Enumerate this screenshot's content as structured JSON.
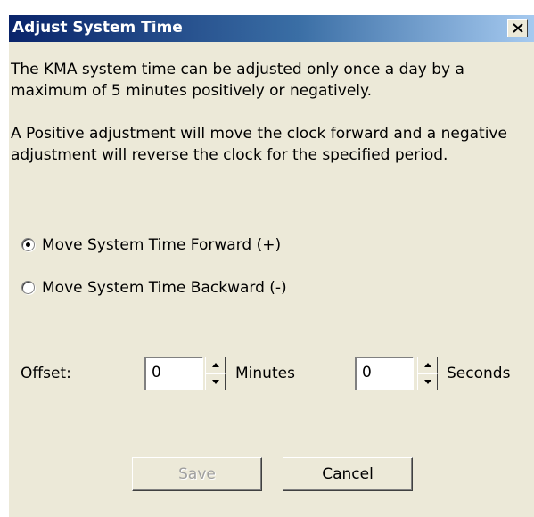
{
  "dialog": {
    "title": "Adjust System Time",
    "close_label": "close"
  },
  "description": {
    "line1": "The KMA system time can be adjusted only once a day by a maximum of 5 minutes positively or negatively.",
    "line2": "A Positive adjustment will move the clock forward and a negative adjustment will reverse the clock for the specified period."
  },
  "direction": {
    "options": [
      {
        "label": "Move System Time Forward (+)",
        "selected": true
      },
      {
        "label": "Move System Time Backward (-)",
        "selected": false
      }
    ]
  },
  "offset": {
    "label": "Offset:",
    "minutes_value": "0",
    "minutes_unit": "Minutes",
    "seconds_value": "0",
    "seconds_unit": "Seconds"
  },
  "buttons": {
    "save_label": "Save",
    "save_enabled": false,
    "cancel_label": "Cancel"
  },
  "icons": {
    "close": "close-icon",
    "spin_up": "arrow-up-icon",
    "spin_down": "arrow-down-icon"
  },
  "colors": {
    "dialog_bg": "#ece9d8",
    "titlebar_start": "#0a246a",
    "titlebar_end": "#a6caf0",
    "title_text": "#ffffff",
    "disabled_text": "#a0a0a0"
  }
}
